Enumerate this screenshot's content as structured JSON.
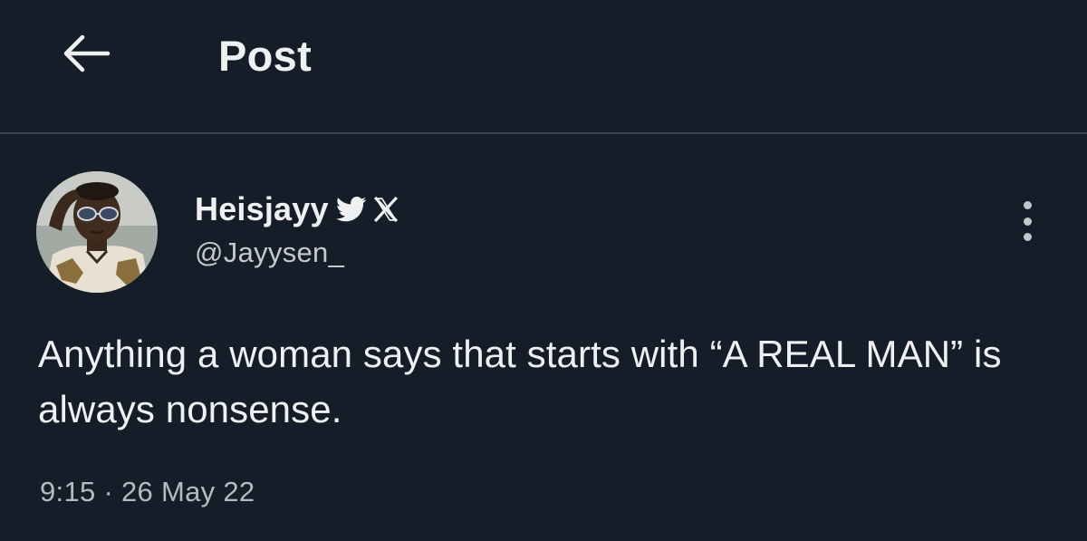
{
  "header": {
    "back_icon": "arrow-left-icon",
    "title": "Post"
  },
  "post": {
    "author": {
      "display_name": "Heisjayy",
      "badges": [
        "bird-icon",
        "x-icon"
      ],
      "handle": "@Jayysen_",
      "avatar_icon": "avatar-photo"
    },
    "more_icon": "more-vertical-icon",
    "text": "Anything a woman says that starts with “A REAL MAN” is always nonsense.",
    "timestamp": "9:15 · 26 May 22"
  },
  "colors": {
    "background": "#151d28",
    "divider": "#3a4452",
    "text_primary": "#eef0f1",
    "text_secondary": "#b6bbc1"
  }
}
